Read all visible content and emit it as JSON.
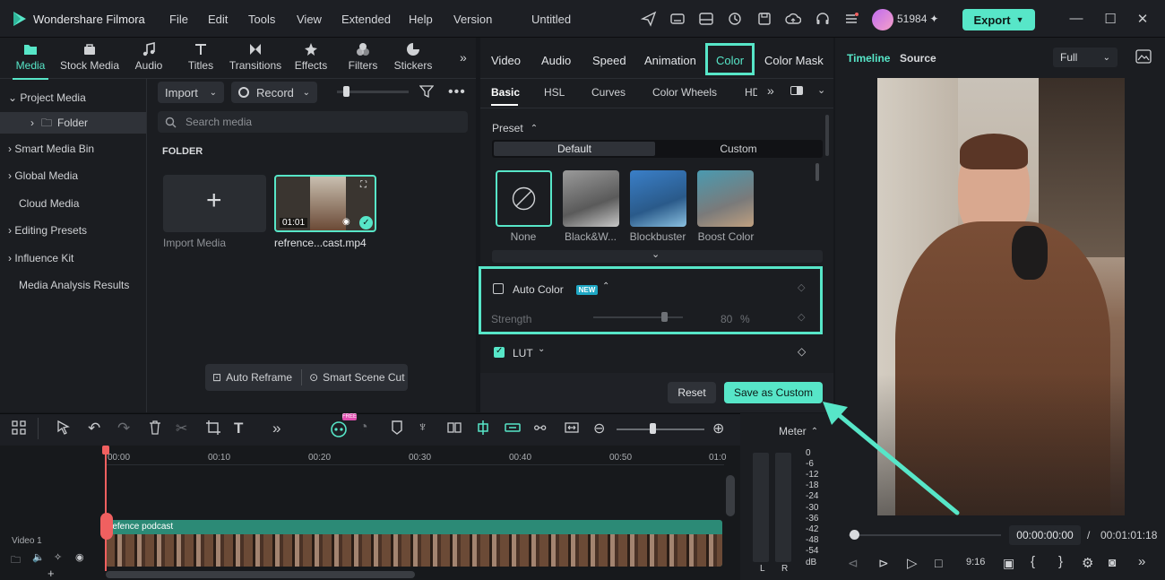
{
  "app": {
    "name": "Wondershare Filmora",
    "menu": [
      "File",
      "Edit",
      "Tools",
      "View",
      "Extended",
      "Help",
      "Version"
    ],
    "project_title": "Untitled",
    "credits": "51984",
    "export_label": "Export"
  },
  "media_tabs": [
    "Media",
    "Stock Media",
    "Audio",
    "Titles",
    "Transitions",
    "Effects",
    "Filters",
    "Stickers"
  ],
  "sidebar": {
    "project_media": "Project Media",
    "folder": "Folder",
    "items": [
      "Smart Media Bin",
      "Global Media",
      "Cloud Media",
      "Editing Presets",
      "Influence Kit",
      "Media Analysis Results"
    ]
  },
  "media": {
    "import_label": "Import",
    "record_label": "Record",
    "search_placeholder": "Search media",
    "folder_heading": "FOLDER",
    "import_caption": "Import Media",
    "clip_duration": "01:01",
    "clip_name": "refrence...cast.mp4",
    "auto_reframe": "Auto Reframe",
    "smart_scene_cut": "Smart Scene Cut"
  },
  "property_tabs": [
    "Video",
    "Audio",
    "Speed",
    "Animation",
    "Color",
    "Color Mask"
  ],
  "color_subtabs": [
    "Basic",
    "HSL",
    "Curves",
    "Color Wheels",
    "HD"
  ],
  "preset": {
    "label": "Preset",
    "default_label": "Default",
    "custom_label": "Custom",
    "items": [
      "None",
      "Black&W...",
      "Blockbuster",
      "Boost Color"
    ]
  },
  "auto_color": {
    "label": "Auto Color",
    "badge": "NEW",
    "strength_label": "Strength",
    "strength_value": "80",
    "strength_unit": "%",
    "strength_fraction": 0.8
  },
  "lut": {
    "label": "LUT"
  },
  "buttons": {
    "reset": "Reset",
    "save_custom": "Save as Custom"
  },
  "preview": {
    "tab_timeline": "Timeline",
    "tab_source": "Source",
    "quality": "Full",
    "timecode_current": "00:00:00:00",
    "separator": "/",
    "timecode_total": "00:01:01:18"
  },
  "timeline": {
    "ruler": [
      "00:00",
      "00:10",
      "00:20",
      "00:30",
      "00:40",
      "00:50",
      "01:0"
    ],
    "track_name": "Video 1",
    "clip_label": "refence podcast",
    "meter_label": "Meter",
    "db_scale": [
      "0",
      "-6",
      "-12",
      "-18",
      "-24",
      "-30",
      "-36",
      "-42",
      "-48",
      "-54",
      "dB"
    ],
    "channel_left": "L",
    "channel_right": "R"
  },
  "colors": {
    "accent": "#57e6c8",
    "playhead": "#f06060"
  }
}
